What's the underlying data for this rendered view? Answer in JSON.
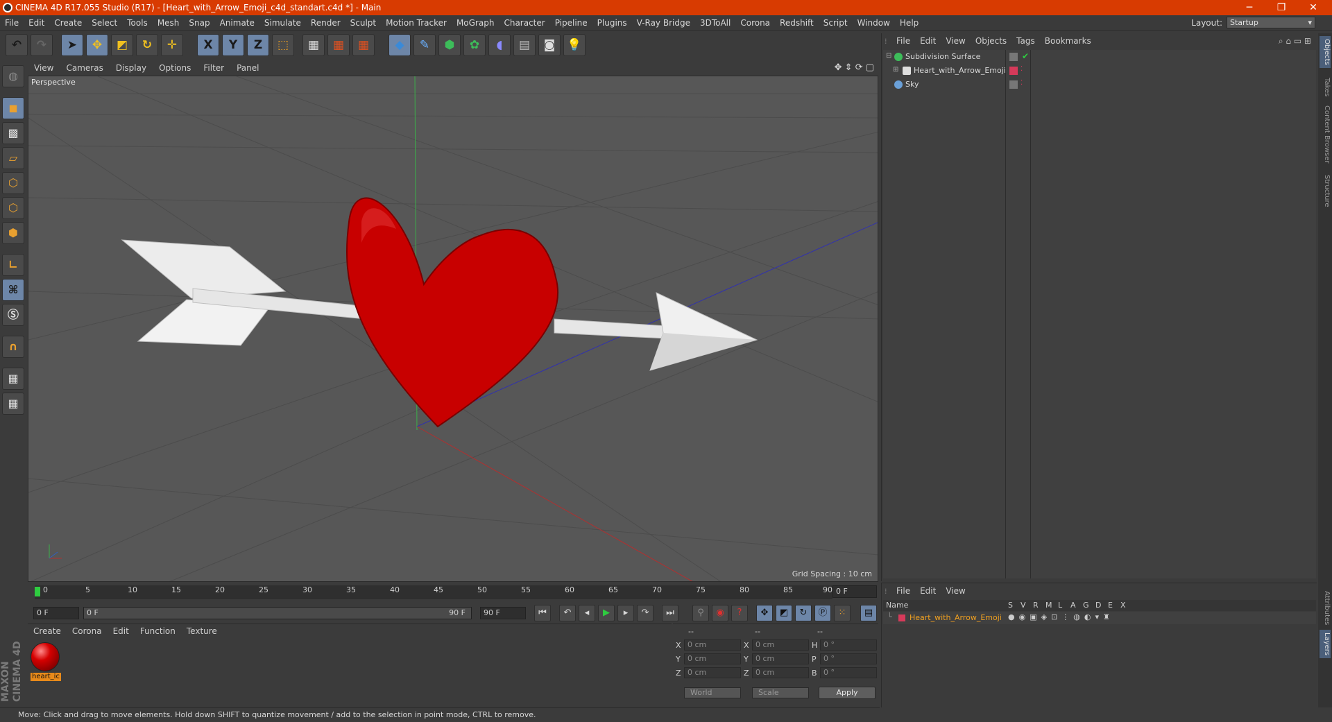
{
  "window": {
    "title": "CINEMA 4D R17.055 Studio (R17) - [Heart_with_Arrow_Emoji_c4d_standart.c4d *] - Main",
    "minimize": "─",
    "maximize": "❐",
    "close": "✕"
  },
  "menubar": {
    "items": [
      "File",
      "Edit",
      "Create",
      "Select",
      "Tools",
      "Mesh",
      "Snap",
      "Animate",
      "Simulate",
      "Render",
      "Sculpt",
      "Motion Tracker",
      "MoGraph",
      "Character",
      "Pipeline",
      "Plugins",
      "V-Ray Bridge",
      "3DToAll",
      "Corona",
      "Redshift",
      "Script",
      "Window",
      "Help"
    ],
    "layout_label": "Layout:",
    "layout_value": "Startup"
  },
  "toolbar": {
    "x_label": "X",
    "y_label": "Y",
    "z_label": "Z"
  },
  "viewport": {
    "menu": [
      "View",
      "Cameras",
      "Display",
      "Options",
      "Filter",
      "Panel"
    ],
    "camera_label": "Perspective",
    "grid_spacing": "Grid Spacing : 10 cm",
    "colors": {
      "heart": "#c60000",
      "arrow": "#e8e8e8",
      "bg": "#575757"
    }
  },
  "timeline": {
    "ticks": [
      "0",
      "5",
      "10",
      "15",
      "20",
      "25",
      "30",
      "35",
      "40",
      "45",
      "50",
      "55",
      "60",
      "65",
      "70",
      "75",
      "80",
      "85",
      "90"
    ],
    "current_frame": "0 F"
  },
  "transport": {
    "start_field": "0 F",
    "range_start": "0 F",
    "range_end": "90 F",
    "end_field": "90 F"
  },
  "material_panel": {
    "menu": [
      "Create",
      "Corona",
      "Edit",
      "Function",
      "Texture"
    ],
    "material_name": "heart_ic"
  },
  "coordinates": {
    "headers": [
      "--",
      "--",
      "--"
    ],
    "rows": [
      {
        "l1": "X",
        "v1": "0 cm",
        "l2": "X",
        "v2": "0 cm",
        "l3": "H",
        "v3": "0 °"
      },
      {
        "l1": "Y",
        "v1": "0 cm",
        "l2": "Y",
        "v2": "0 cm",
        "l3": "P",
        "v3": "0 °"
      },
      {
        "l1": "Z",
        "v1": "0 cm",
        "l2": "Z",
        "v2": "0 cm",
        "l3": "B",
        "v3": "0 °"
      }
    ],
    "mode_world": "World",
    "mode_scale": "Scale",
    "apply": "Apply"
  },
  "status": {
    "text": "Move: Click and drag to move elements. Hold down SHIFT to quantize movement / add to the selection in point mode, CTRL to remove."
  },
  "object_manager": {
    "menu": [
      "File",
      "Edit",
      "View",
      "Objects",
      "Tags",
      "Bookmarks"
    ],
    "objects": [
      {
        "name": "Subdivision Surface",
        "color": "#3dbd5a"
      },
      {
        "name": "Heart_with_Arrow_Emoji",
        "color": "#e6e6e6"
      },
      {
        "name": "Sky",
        "color": "#6aa0d8"
      }
    ]
  },
  "layer_manager": {
    "menu": [
      "File",
      "Edit",
      "View"
    ],
    "headers": [
      "Name",
      "S",
      "V",
      "R",
      "M",
      "L",
      "A",
      "G",
      "D",
      "E",
      "X"
    ],
    "layer_name": "Heart_with_Arrow_Emoji",
    "layer_color": "#d63a5a"
  },
  "side_tabs": [
    "Objects",
    "Takes",
    "Content Browser",
    "Structure",
    "Attributes",
    "Layers"
  ]
}
